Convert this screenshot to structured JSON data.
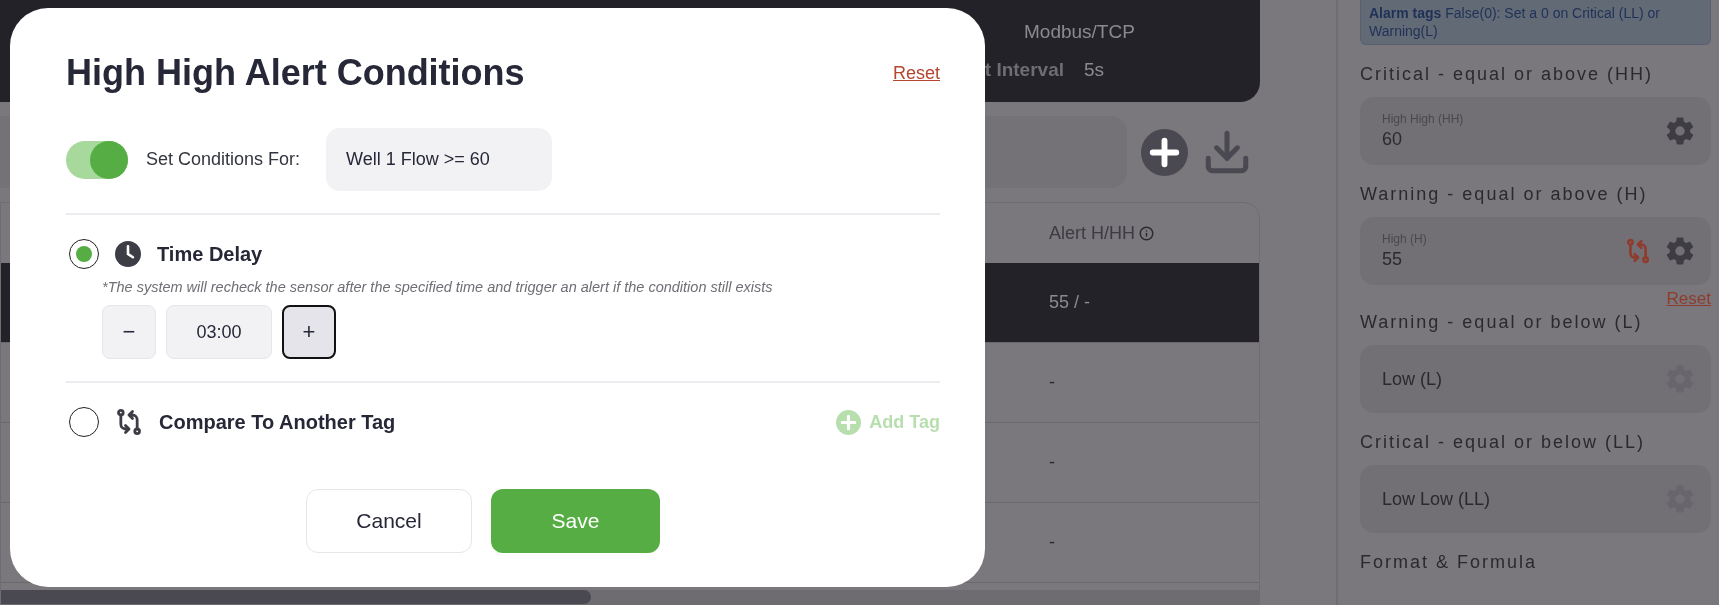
{
  "device_card": {
    "protocol": "Modbus/TCP",
    "interval_label": "t Interval",
    "interval_value": "5s"
  },
  "table": {
    "columns": [
      "Alert H/HH"
    ],
    "rows": [
      {
        "cells": [
          "55 / -"
        ],
        "selected": true
      },
      {
        "cells": [
          "-"
        ],
        "selected": false
      },
      {
        "cells": [
          "-"
        ],
        "selected": false
      },
      {
        "cells": [
          "-"
        ],
        "selected": false
      }
    ]
  },
  "settings": {
    "note": "**Alarm tags** False(0): Set a 0 on Critical (LL) or Warning(L)",
    "sections": [
      {
        "label": "Critical - equal or above (HH)",
        "field_label": "High High (HH)",
        "value": "60",
        "compare": false,
        "gear_disabled": false
      },
      {
        "label": "Warning - equal or above (H)",
        "field_label": "High (H)",
        "value": "55",
        "compare": true,
        "gear_disabled": false,
        "reset": "Reset"
      },
      {
        "label": "Warning - equal or below (L)",
        "placeholder": "Low (L)",
        "compare": false,
        "gear_disabled": true
      },
      {
        "label": "Critical - equal or below (LL)",
        "placeholder": "Low Low (LL)",
        "compare": false,
        "gear_disabled": true
      }
    ],
    "footer_title": "Format & Formula"
  },
  "modal": {
    "title": "High High Alert Conditions",
    "reset": "Reset",
    "toggle": {
      "on": true
    },
    "set_label": "Set Conditions For:",
    "condition": "Well 1 Flow >= 60",
    "options": [
      {
        "kind": "time_delay",
        "label": "Time Delay",
        "selected": true,
        "note": "*The system will recheck the sensor after the specified time and trigger an alert if the condition still exists",
        "stepper": {
          "minus": "−",
          "value": "03:00",
          "plus": "+",
          "plus_focused": true
        }
      },
      {
        "kind": "compare",
        "label": "Compare To Another Tag",
        "selected": false,
        "add_tag": {
          "label": "Add Tag",
          "disabled": true
        }
      }
    ],
    "buttons": [
      {
        "label": "Cancel",
        "kind": "secondary"
      },
      {
        "label": "Save",
        "kind": "primary"
      }
    ]
  }
}
